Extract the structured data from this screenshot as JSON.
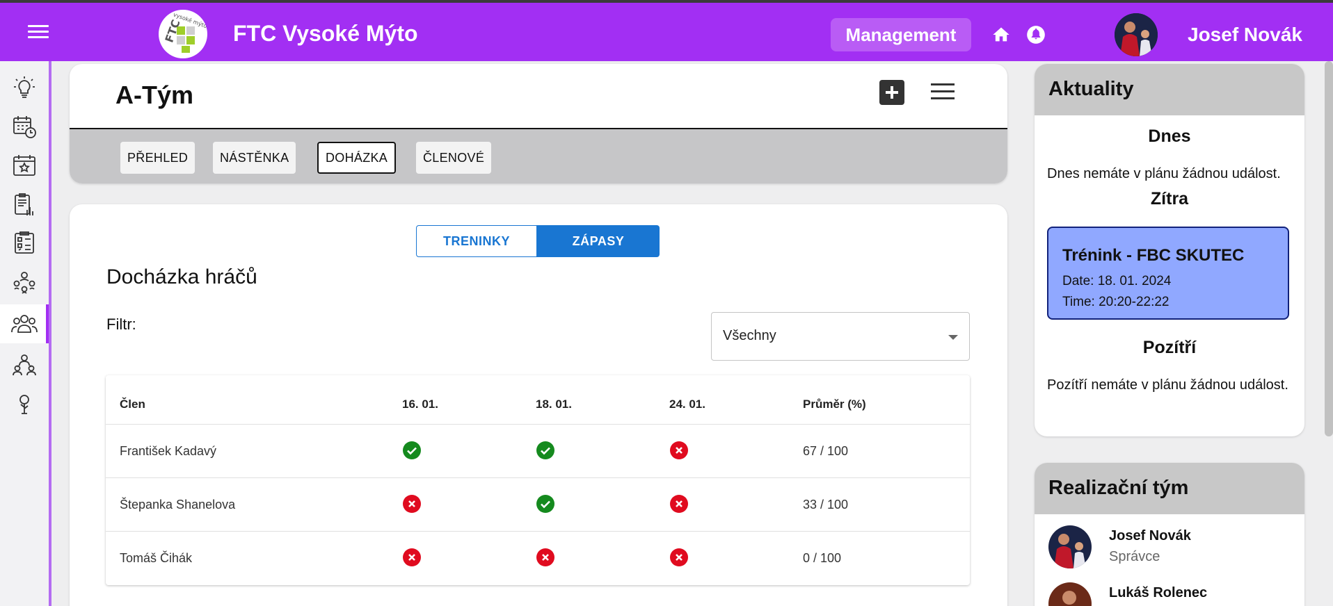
{
  "header": {
    "app_title": "FTC Vysoké Mýto",
    "logo_text": "FTC Vysoké mýto",
    "management_label": "Management",
    "user_name": "Josef Novák",
    "icons": [
      "menu-icon",
      "home-icon",
      "notification-bell-icon"
    ]
  },
  "sidebar": {
    "items": [
      {
        "icon": "lightbulb-icon"
      },
      {
        "icon": "calendar-clock-icon"
      },
      {
        "icon": "calendar-star-icon"
      },
      {
        "icon": "clipboard-chart-icon"
      },
      {
        "icon": "tactics-board-icon"
      },
      {
        "icon": "network-people-icon"
      },
      {
        "icon": "team-group-icon",
        "active": true
      },
      {
        "icon": "people-hierarchy-icon"
      },
      {
        "icon": "tree-icon"
      }
    ]
  },
  "team": {
    "title": "A-Tým",
    "tabs": [
      {
        "label": "PŘEHLED"
      },
      {
        "label": "NÁSTĚNKA"
      },
      {
        "label": "DOHÁZKA",
        "active": true
      },
      {
        "label": "ČLENOVÉ"
      }
    ]
  },
  "attendance": {
    "toggle_left": "TRENINKY",
    "toggle_right": "ZÁPASY",
    "heading": "Docházka hráčů",
    "filter_label": "Filtr:",
    "filter_value": "Všechny",
    "columns": [
      "Člen",
      "16. 01.",
      "18. 01.",
      "24. 01.",
      "Průměr (%)"
    ],
    "rows": [
      {
        "name": "František Kadavý",
        "status": [
          "present",
          "present",
          "absent"
        ],
        "avg": "67 / 100"
      },
      {
        "name": "Štepanka Shanelova",
        "status": [
          "absent",
          "present",
          "absent"
        ],
        "avg": "33 / 100"
      },
      {
        "name": "Tomáš Čihák",
        "status": [
          "absent",
          "absent",
          "absent"
        ],
        "avg": "0 / 100"
      }
    ]
  },
  "news": {
    "title": "Aktuality",
    "today_title": "Dnes",
    "today_text": "Dnes nemáte v plánu žádnou událost.",
    "tomorrow_title": "Zítra",
    "event": {
      "title": "Trénink - FBC SKUTEC",
      "date": "Date: 18. 01. 2024",
      "time": "Time: 20:20-22:22"
    },
    "dayafter_title": "Pozítří",
    "dayafter_text": "Pozítří nemáte v plánu žádnou událost."
  },
  "staff": {
    "title": "Realizační tým",
    "members": [
      {
        "name": "Josef Novák",
        "role": "Správce"
      },
      {
        "name": "Lukáš Rolenec",
        "role": ""
      }
    ]
  },
  "colors": {
    "brand_purple": "#a22ff3",
    "accent_blue": "#1976d2",
    "present_green": "#158a1e",
    "absent_red": "#e00b1f",
    "event_blue": "#90a8ff"
  }
}
